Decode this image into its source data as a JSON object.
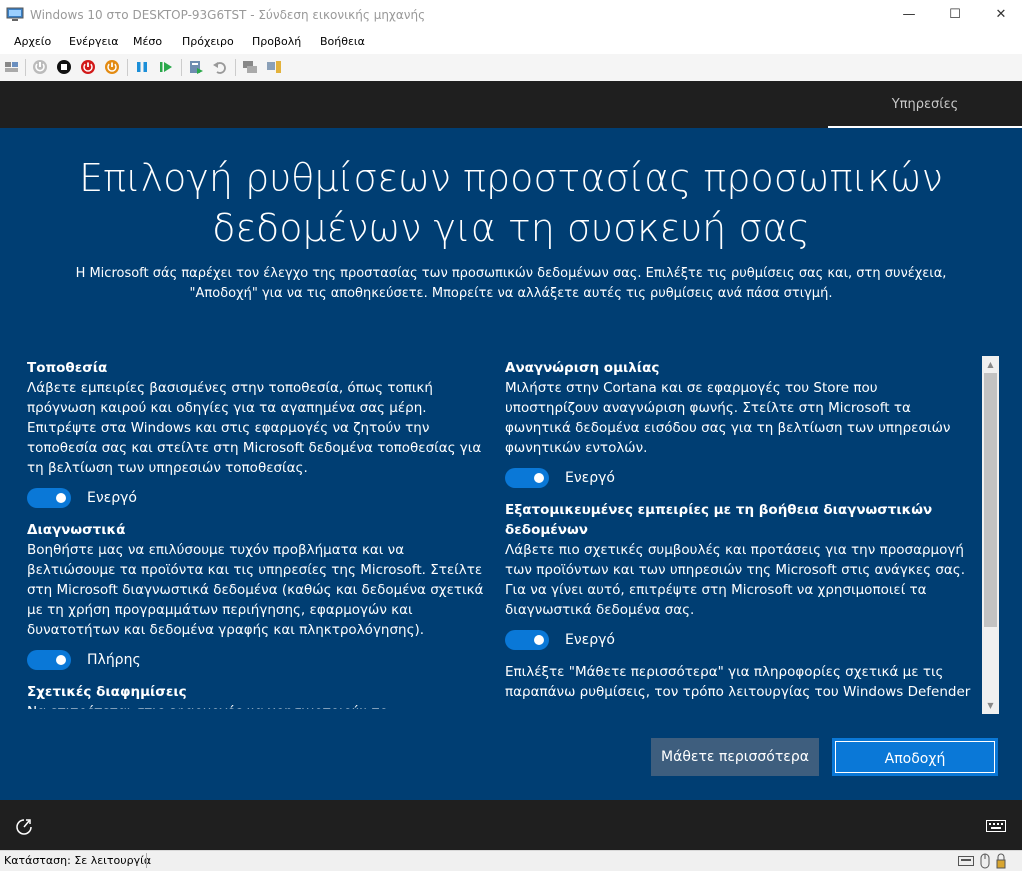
{
  "window": {
    "title": "Windows 10 στο DESKTOP-93G6TST - Σύνδεση εικονικής μηχανής",
    "minimize": "—",
    "maximize": "☐",
    "close": "✕"
  },
  "menu": [
    "Αρχείο",
    "Ενέργεια",
    "Μέσο",
    "Πρόχειρο",
    "Προβολή",
    "Βοήθεια"
  ],
  "toolbar": {
    "icons": [
      "ctrl-alt-del-icon",
      "start-icon",
      "turn-off-icon",
      "shutdown-icon",
      "save-icon",
      "pause-icon",
      "resume-icon",
      "checkpoint-icon",
      "revert-icon",
      "enhanced-session-icon",
      "share-icon"
    ]
  },
  "setup": {
    "tab_label": "Υπηρεσίες",
    "heading_line1": "Επιλογή ρυθμίσεων προστασίας προσωπικών",
    "heading_line2": "δεδομένων για τη συσκευή σας",
    "subtitle_line1": "Η Microsoft σάς παρέχει τον έλεγχο της προστασίας των προσωπικών δεδομένων σας. Επιλέξτε τις ρυθμίσεις σας και, στη συνέχεια,",
    "subtitle_line2": "\"Αποδοχή\" για να τις αποθηκεύσετε. Μπορείτε να αλλάξετε αυτές τις ρυθμίσεις ανά πάσα στιγμή.",
    "location": {
      "title": "Τοποθεσία",
      "description": "Λάβετε εμπειρίες βασισμένες στην τοποθεσία, όπως τοπική πρόγνωση καιρού και οδηγίες για τα αγαπημένα σας μέρη. Επιτρέψτε στα Windows και στις εφαρμογές να ζητούν την τοποθεσία σας και στείλτε στη Microsoft δεδομένα τοποθεσίας για τη βελτίωση των υπηρεσιών τοποθεσίας.",
      "toggle_label": "Ενεργό"
    },
    "diagnostics": {
      "title": "Διαγνωστικά",
      "description": "Βοηθήστε μας να επιλύσουμε τυχόν προβλήματα και να βελτιώσουμε τα προϊόντα και τις υπηρεσίες της Microsoft. Στείλτε στη Microsoft διαγνωστικά δεδομένα (καθώς και δεδομένα σχετικά με τη χρήση προγραμμάτων περιήγησης, εφαρμογών και δυνατοτήτων και δεδομένα γραφής και πληκτρολόγησης).",
      "toggle_label": "Πλήρης"
    },
    "ads": {
      "title": "Σχετικές διαφημίσεις",
      "description": "Να επιτρέπεται στις εφαρμογές να χρησιμοποιούν το"
    },
    "speech": {
      "title": "Αναγνώριση ομιλίας",
      "description": "Μιλήστε στην Cortana και σε εφαρμογές του Store που υποστηρίζουν αναγνώριση φωνής. Στείλτε στη Microsoft τα φωνητικά δεδομένα εισόδου σας για τη βελτίωση των υπηρεσιών φωνητικών εντολών.",
      "toggle_label": "Ενεργό"
    },
    "tailored": {
      "title": "Εξατομικευμένες εμπειρίες με τη βοήθεια διαγνωστικών δεδομένων",
      "description": "Λάβετε πιο σχετικές συμβουλές και προτάσεις για την προσαρμογή των προϊόντων και των υπηρεσιών της Microsoft στις ανάγκες σας. Για να γίνει αυτό, επιτρέψτε στη Microsoft να χρησιμοποιεί τα διαγνωστικά δεδομένα σας.",
      "toggle_label": "Ενεργό"
    },
    "learn_more_text": "Επιλέξτε \"Μάθετε περισσότερα\" για πληροφορίες σχετικά με τις παραπάνω ρυθμίσεις, τον τρόπο λειτουργίας του Windows Defender",
    "learn_more_button": "Μάθετε περισσότερα",
    "accept_button": "Αποδοχή"
  },
  "status": {
    "text": "Κατάσταση: Σε λειτουργία"
  },
  "colors": {
    "oobe_background": "#003e73",
    "accent": "#0a78d7",
    "dark_bar": "#1f1f1f"
  }
}
